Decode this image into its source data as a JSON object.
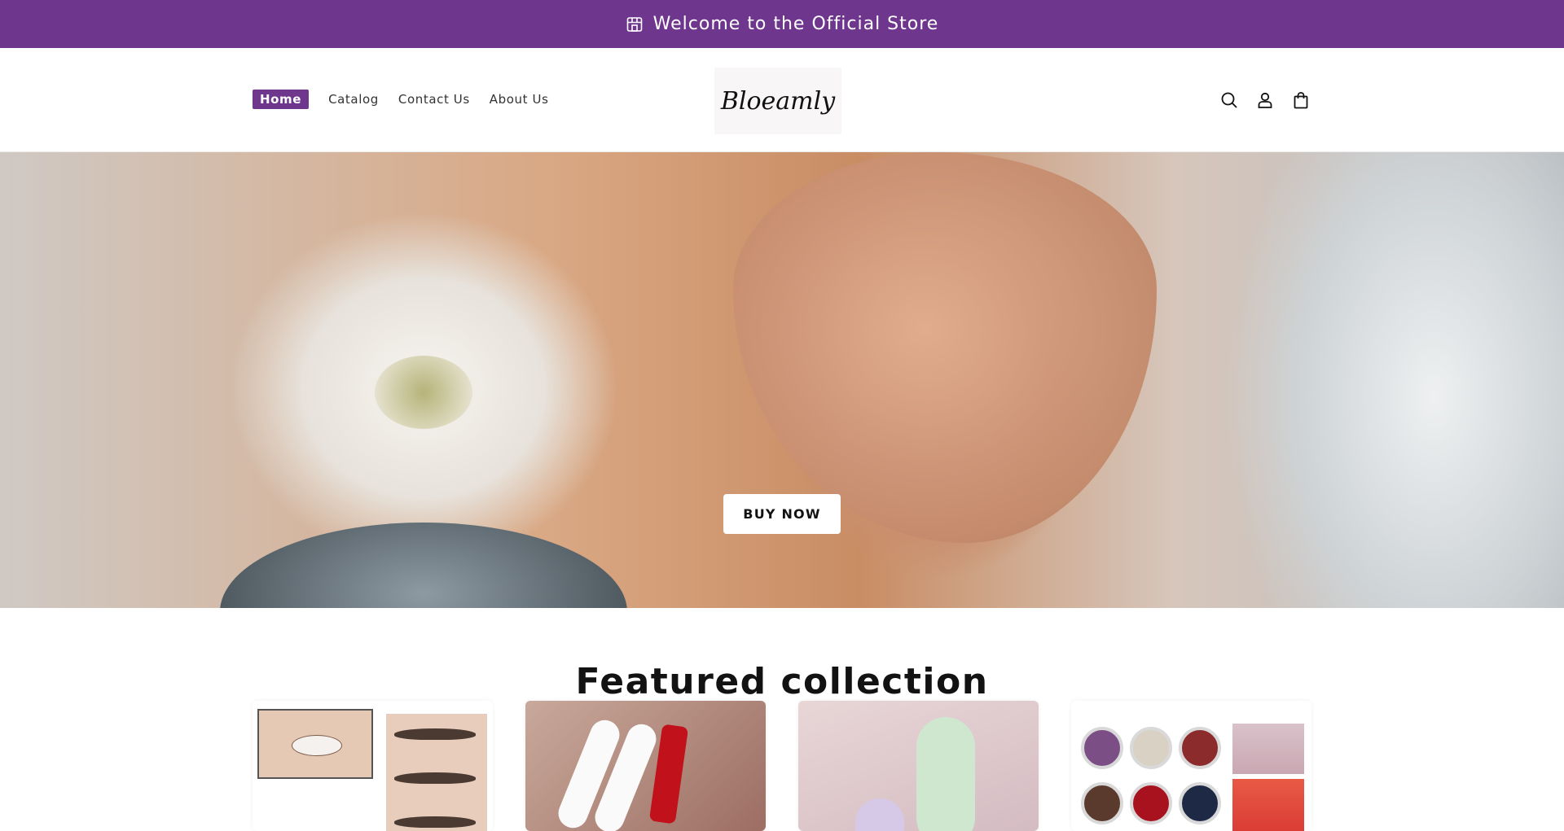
{
  "announcement": {
    "text": "Welcome to the Official Store",
    "icon": "store-icon",
    "background": "#6e368c"
  },
  "header": {
    "nav": [
      {
        "label": "Home",
        "active": true
      },
      {
        "label": "Catalog",
        "active": false
      },
      {
        "label": "Contact Us",
        "active": false
      },
      {
        "label": "About Us",
        "active": false
      }
    ],
    "logo_text": "Bloeamly",
    "icons": [
      "search-icon",
      "account-icon",
      "cart-icon"
    ]
  },
  "hero": {
    "button_label": "BUY NOW"
  },
  "featured": {
    "title": "Featured collection",
    "products": [
      {
        "image": "eyebrow-product-image"
      },
      {
        "image": "lipstick-product-image"
      },
      {
        "image": "green-tube-product-image"
      },
      {
        "image": "eyeshadow-palette-product-image"
      }
    ]
  },
  "colors": {
    "brand": "#6e368c",
    "text": "#121212"
  }
}
